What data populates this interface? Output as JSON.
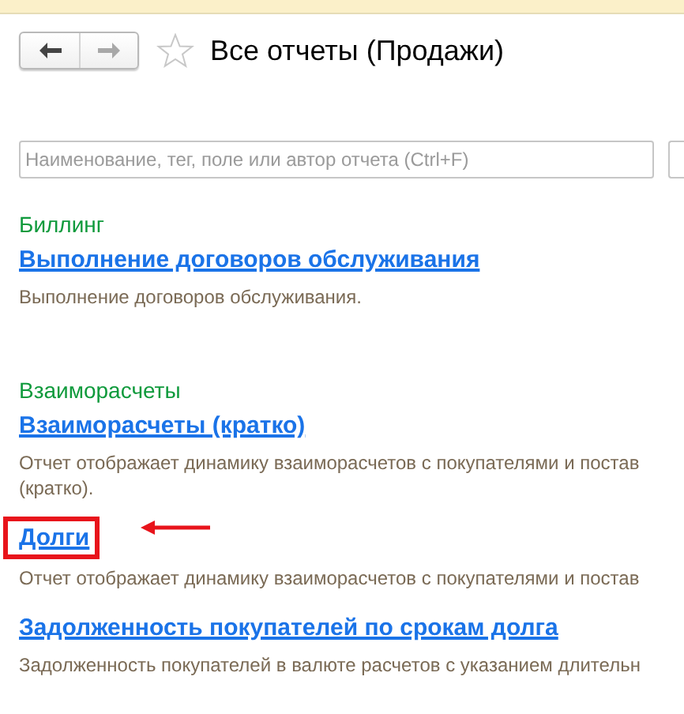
{
  "window": {
    "title": "Все отчеты (Продажи)",
    "favorite": false
  },
  "nav": [
    {
      "kind": "back",
      "disabled": false
    },
    {
      "kind": "forward",
      "disabled": true
    }
  ],
  "search": {
    "placeholder": "Наименование, тег, поле или автор отчета (Ctrl+F)"
  },
  "groups": [
    {
      "title": "Биллинг",
      "reports": [
        {
          "name": "Выполнение договоров обслуживания",
          "highlighted": false,
          "description": [
            "Выполнение договоров обслуживания."
          ]
        }
      ]
    },
    {
      "title": "Взаиморасчеты",
      "reports": [
        {
          "name": "Взаиморасчеты (кратко)",
          "highlighted": false,
          "description": [
            "Отчет отображает динамику взаиморасчетов с покупателями и постав",
            "(кратко)."
          ]
        },
        {
          "name": "Долги",
          "highlighted": true,
          "description": [
            "Отчет отображает динамику взаиморасчетов с покупателями и постав"
          ]
        },
        {
          "name": "Задолженность покупателей по срокам долга",
          "highlighted": false,
          "description": [
            "Задолженность покупателей в валюте расчетов с указанием длительн"
          ]
        }
      ]
    }
  ]
}
